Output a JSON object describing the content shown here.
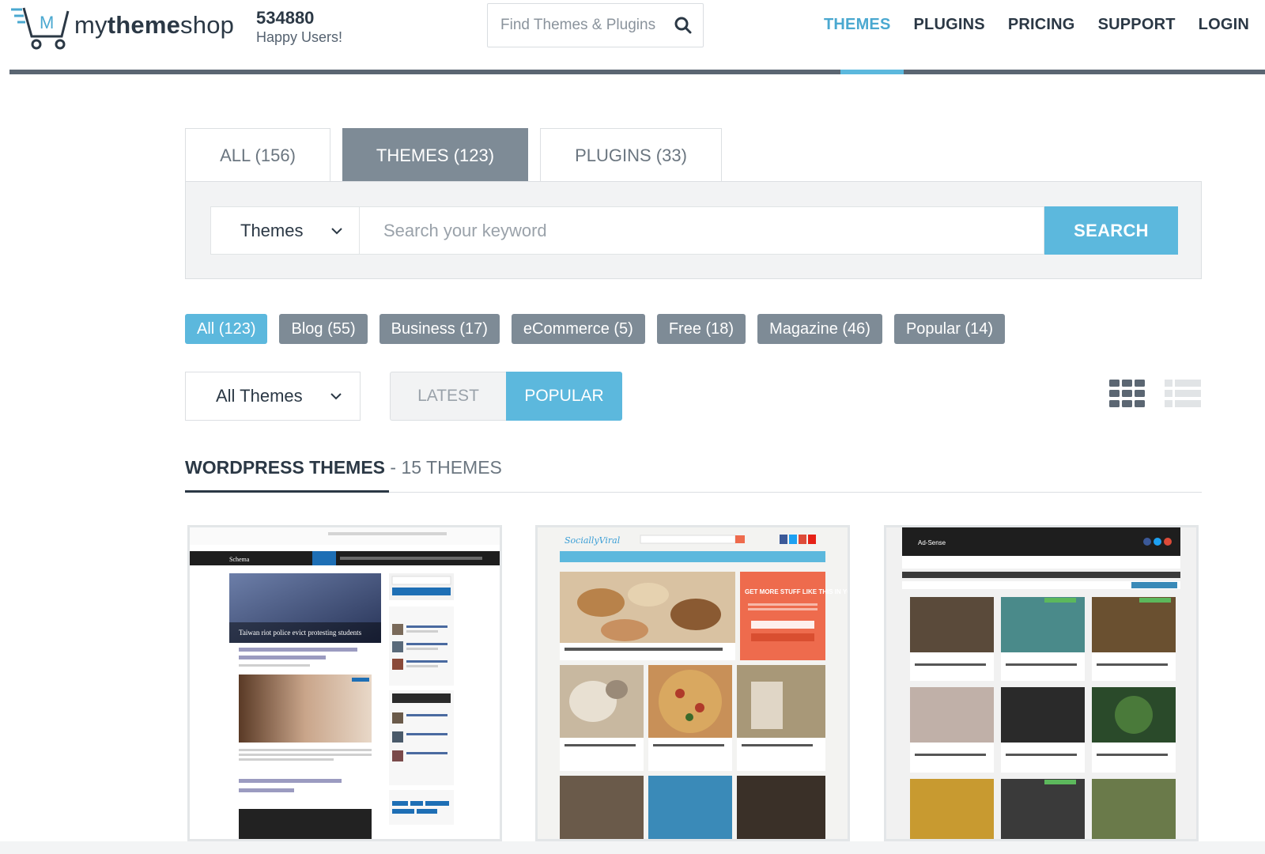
{
  "header": {
    "logo_text_plain": "my",
    "logo_text_bold": "theme",
    "logo_text_tail": "shop",
    "users_count": "534880",
    "users_label": "Happy Users!",
    "search_placeholder": "Find Themes & Plugins",
    "nav": [
      {
        "label": "THEMES",
        "active": true
      },
      {
        "label": "PLUGINS",
        "active": false
      },
      {
        "label": "PRICING",
        "active": false
      },
      {
        "label": "SUPPORT",
        "active": false
      },
      {
        "label": "LOGIN",
        "active": false
      }
    ]
  },
  "tabs": [
    {
      "label": "ALL (156)",
      "active": false
    },
    {
      "label": "THEMES (123)",
      "active": true
    },
    {
      "label": "PLUGINS (33)",
      "active": false
    }
  ],
  "search": {
    "type_selected": "Themes",
    "keyword_placeholder": "Search your keyword",
    "button_label": "SEARCH"
  },
  "filters": [
    {
      "label": "All (123)",
      "active": true
    },
    {
      "label": "Blog (55)",
      "active": false
    },
    {
      "label": "Business (17)",
      "active": false
    },
    {
      "label": "eCommerce (5)",
      "active": false
    },
    {
      "label": "Free (18)",
      "active": false
    },
    {
      "label": "Magazine (46)",
      "active": false
    },
    {
      "label": "Popular (14)",
      "active": false
    }
  ],
  "sort": {
    "dropdown_selected": "All Themes",
    "latest_label": "LATEST",
    "popular_label": "POPULAR",
    "active": "popular"
  },
  "view_modes": {
    "grid_icon": "grid-view-icon",
    "list_icon": "list-view-icon",
    "active": "grid"
  },
  "section": {
    "title": "WORDPRESS THEMES",
    "subtitle": " - 15 THEMES"
  },
  "cards": [
    {
      "name": "Schema",
      "headline": "Taiwan riot police evict protesting students"
    },
    {
      "name": "SociallyViral",
      "headline": "GET MORE STUFF LIKE THIS IN YOUR INBOX"
    },
    {
      "name": "Ad-Sense",
      "headline": ""
    }
  ],
  "colors": {
    "accent": "#5cb8dd",
    "dark": "#2b3845",
    "slate": "#7e8b96",
    "bar": "#5b6672"
  }
}
